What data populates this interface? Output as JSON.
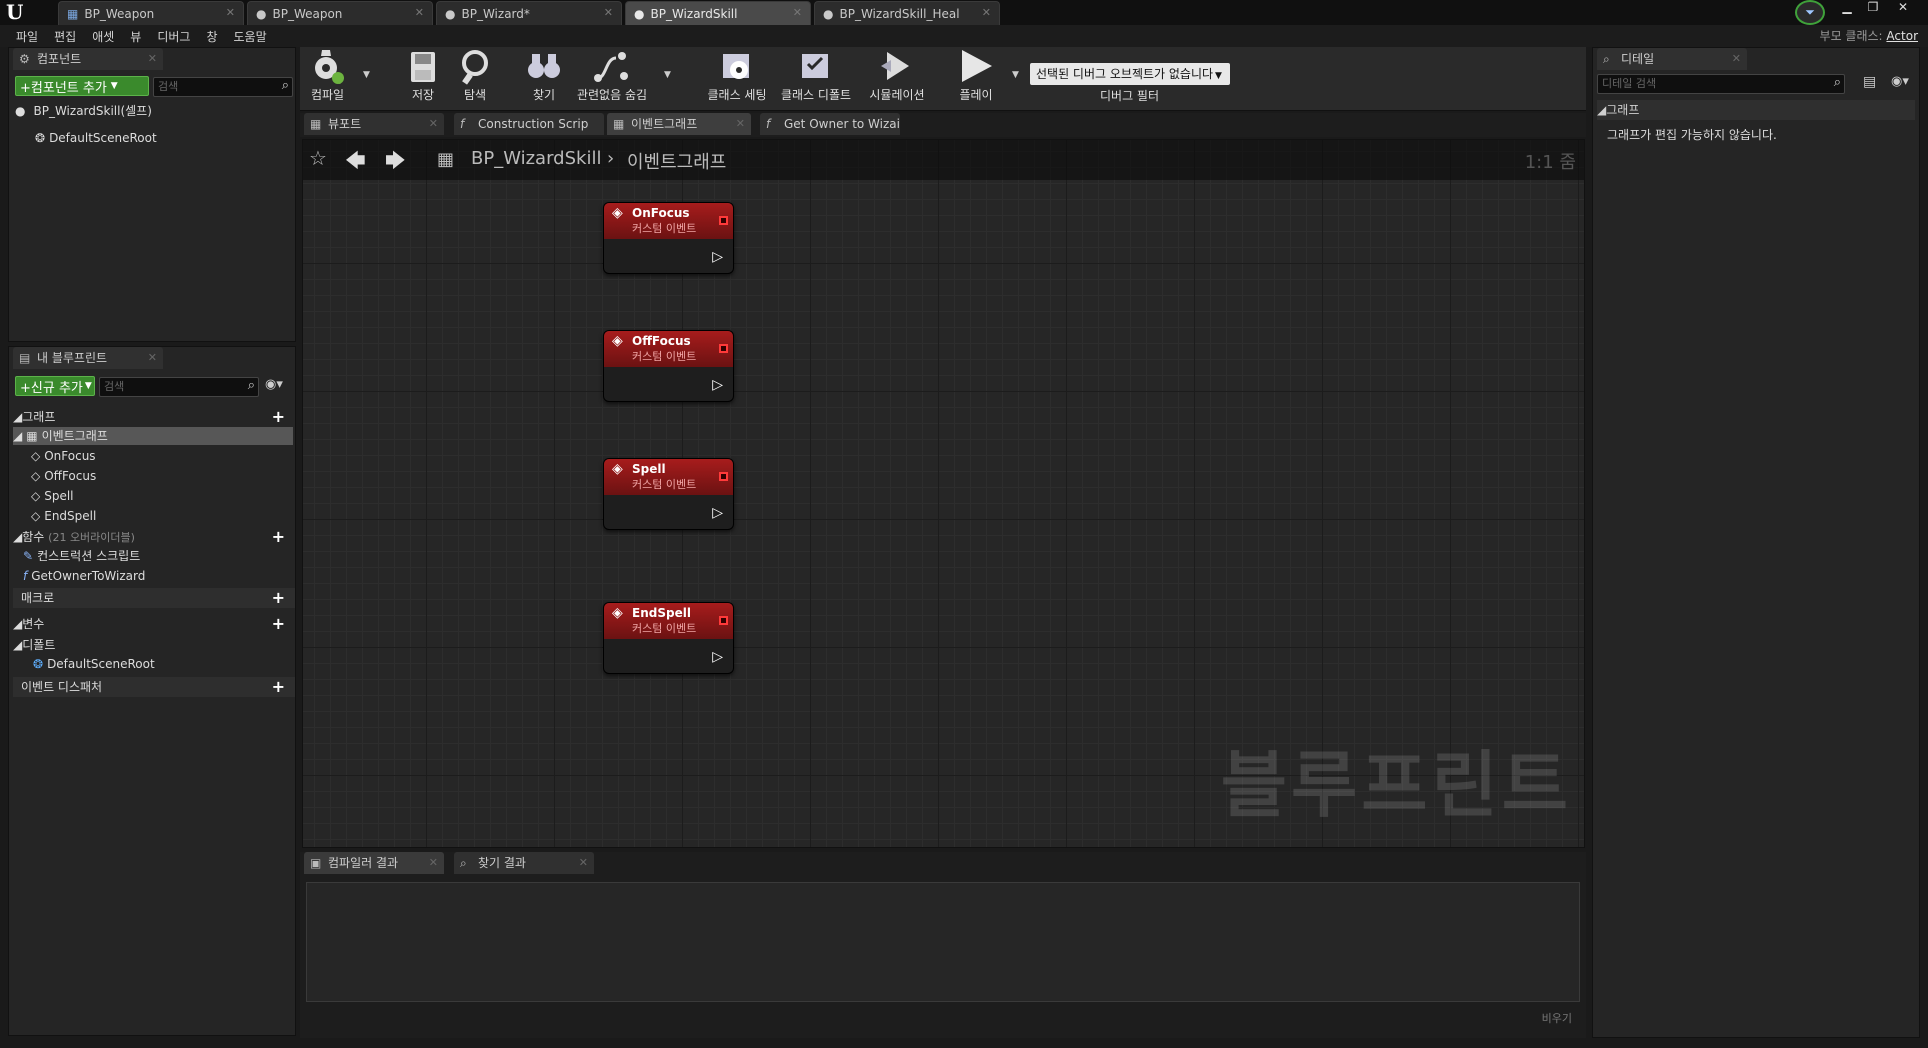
{
  "doc_tabs": [
    {
      "label": "BP_Weapon"
    },
    {
      "label": "BP_Weapon"
    },
    {
      "label": "BP_Wizard*"
    },
    {
      "label": "BP_WizardSkill"
    },
    {
      "label": "BP_WizardSkill_Heal"
    }
  ],
  "menu": [
    "파일",
    "편집",
    "애셋",
    "뷰",
    "디버그",
    "창",
    "도움말"
  ],
  "parent_class": {
    "label": "부모 클래스:",
    "value": "Actor"
  },
  "components_panel": {
    "tab": "컴포넌트",
    "add_button": "+컴포넌트 추가",
    "search_placeholder": "검색",
    "root": "BP_WizardSkill(셀프)",
    "child": "DefaultSceneRoot"
  },
  "my_blueprint": {
    "tab": "내 블루프린트",
    "add_button": "+신규 추가",
    "search_placeholder": "검색",
    "graphs_label": "그래프",
    "event_graph": "이벤트그래프",
    "events": [
      "OnFocus",
      "OffFocus",
      "Spell",
      "EndSpell"
    ],
    "functions_label": "함수",
    "functions_count": "(21 오버라이더블)",
    "functions": [
      "컨스트럭션 스크립트",
      "GetOwnerToWizard"
    ],
    "macros_label": "매크로",
    "variables_label": "변수",
    "defaults_label": "디폴트",
    "defaults_item": "DefaultSceneRoot",
    "dispatchers_label": "이벤트 디스패처"
  },
  "toolbar": {
    "compile": "컴파일",
    "save": "저장",
    "browse": "탐색",
    "find": "찾기",
    "hide_unrelated": "관련없음 숨김",
    "class_settings": "클래스 세팅",
    "class_defaults": "클래스 디폴트",
    "simulation": "시뮬레이션",
    "play": "플레이",
    "debug_select": "선택된 디버그 오브젝트가 없습니다",
    "debug_filter": "디버그 필터"
  },
  "graph_tabs": [
    {
      "label": "뷰포트"
    },
    {
      "label": "Construction Scrip"
    },
    {
      "label": "이벤트그래프"
    },
    {
      "label": "Get Owner to Wizai"
    }
  ],
  "breadcrumb": {
    "blueprint": "BP_WizardSkill",
    "graph": "이벤트그래프",
    "zoom": "1:1 줌"
  },
  "nodes": [
    {
      "title": "OnFocus",
      "subtitle": "커스텀 이벤트"
    },
    {
      "title": "OffFocus",
      "subtitle": "커스텀 이벤트"
    },
    {
      "title": "Spell",
      "subtitle": "커스텀 이벤트"
    },
    {
      "title": "EndSpell",
      "subtitle": "커스텀 이벤트"
    }
  ],
  "watermark": "블루프린트",
  "bottom_tabs": [
    {
      "label": "컴파일러 결과"
    },
    {
      "label": "찾기 결과"
    }
  ],
  "clear_button": "비우기",
  "details": {
    "tab": "디테일",
    "search_placeholder": "디테일 검색",
    "section": "그래프",
    "message": "그래프가 편집 가능하지 않습니다."
  }
}
